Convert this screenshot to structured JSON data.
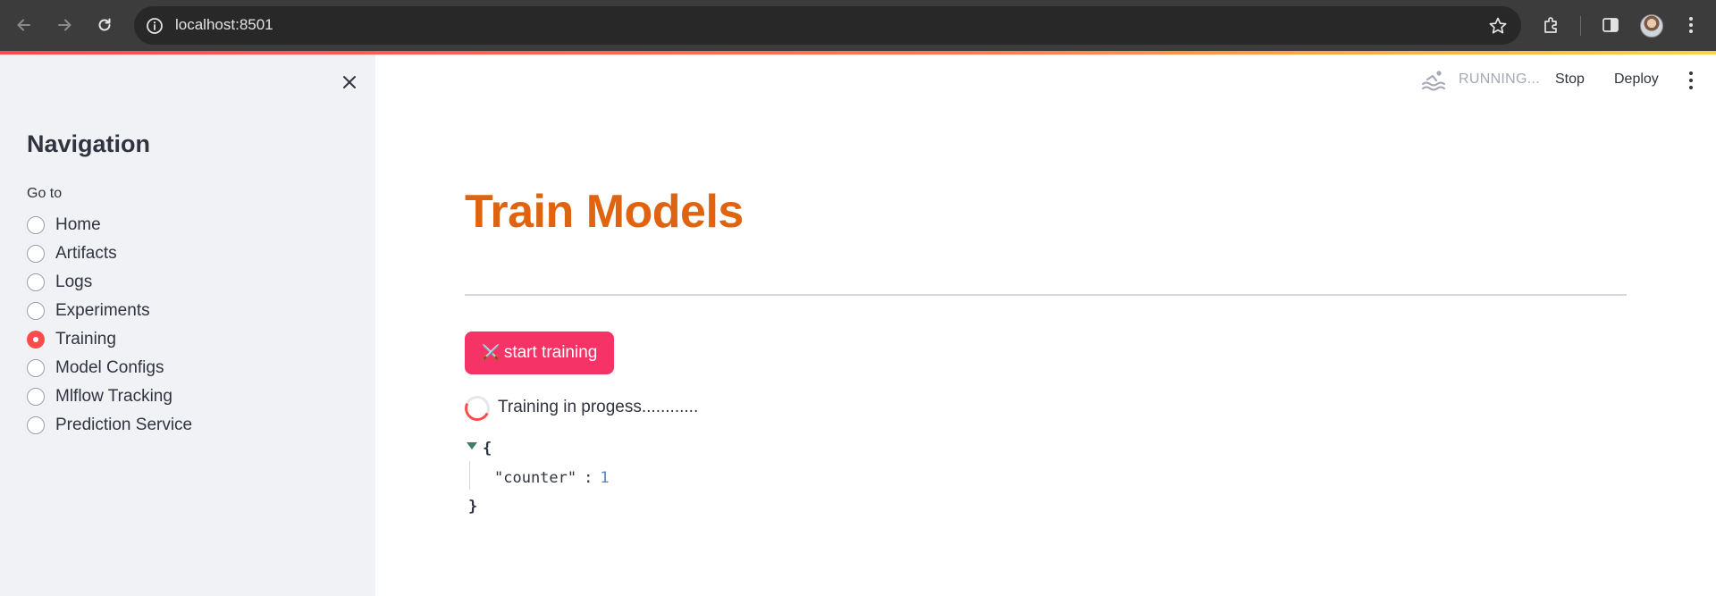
{
  "browser": {
    "url": "localhost:8501"
  },
  "app_header": {
    "status": "RUNNING...",
    "stop_label": "Stop",
    "deploy_label": "Deploy"
  },
  "sidebar": {
    "title": "Navigation",
    "caption": "Go to",
    "items": [
      {
        "label": "Home",
        "selected": false
      },
      {
        "label": "Artifacts",
        "selected": false
      },
      {
        "label": "Logs",
        "selected": false
      },
      {
        "label": "Experiments",
        "selected": false
      },
      {
        "label": "Training",
        "selected": true
      },
      {
        "label": "Model Configs",
        "selected": false
      },
      {
        "label": "Mlflow Tracking",
        "selected": false
      },
      {
        "label": "Prediction Service",
        "selected": false
      }
    ]
  },
  "main": {
    "title": "Train Models",
    "button_icon": "⚔️",
    "button_label": "start training",
    "progress_text": "Training in progess............",
    "json": {
      "open": "{",
      "key": "\"counter\"",
      "colon": ":",
      "value": "1",
      "close": "}"
    }
  },
  "colors": {
    "accent": "#ff4b4b",
    "title": "#e0630f",
    "button": "#f63366",
    "sidebar_bg": "#f0f2f6"
  }
}
